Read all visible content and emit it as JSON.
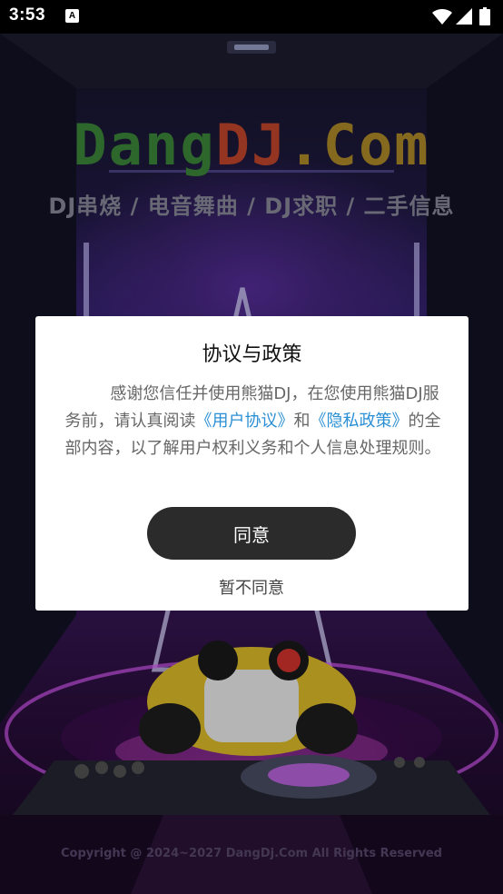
{
  "status_bar": {
    "time": "3:53",
    "notification_icon_letter": "A",
    "icons": [
      "notification-icon",
      "wifi-icon",
      "signal-icon",
      "battery-icon"
    ]
  },
  "background": {
    "logo_part1": "Dang",
    "logo_part2": "DJ",
    "logo_part3": ".Com",
    "tagline": "DJ串烧 / 电音舞曲 / DJ求职 / 二手信息",
    "copyright": "Copyright @ 2024~2027 DangDj.Com All Rights Reserved",
    "colors": {
      "logo_green": "#3d8a3a",
      "logo_red": "#c4472b",
      "logo_gold": "#b08d2a"
    }
  },
  "dialog": {
    "title": "协议与政策",
    "body_text_1": "感谢您信任并使用熊猫DJ，在您使用熊猫DJ服务前，请认真阅读",
    "link_user_agreement": "《用户协议》",
    "body_text_2": "和",
    "link_privacy_policy": "《隐私政策》",
    "body_text_3": "的全部内容，以了解用户权利义务和个人信息处理规则。",
    "agree_label": "同意",
    "disagree_label": "暂不同意",
    "colors": {
      "link": "#2a8fd4",
      "agree_button": "#2b2b2b"
    }
  }
}
